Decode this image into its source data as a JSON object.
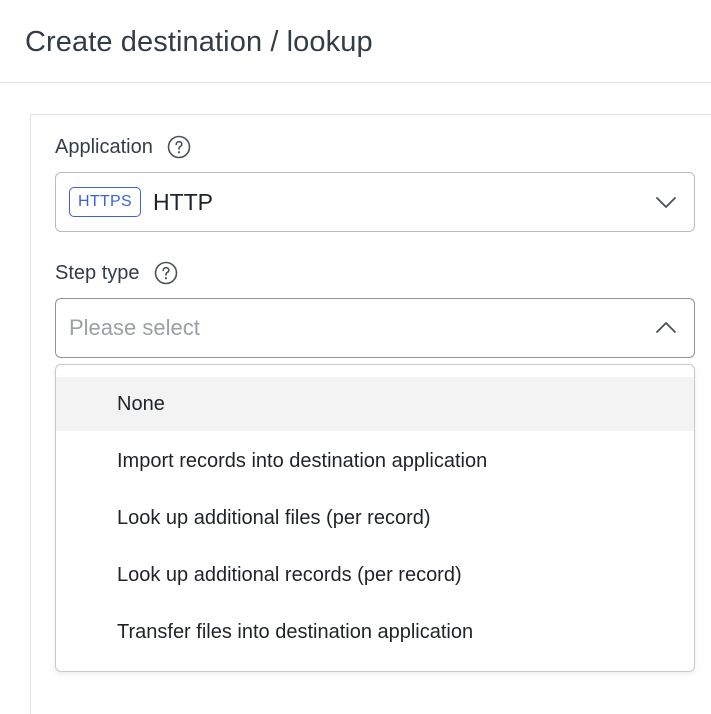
{
  "header": {
    "title": "Create destination / lookup"
  },
  "application_field": {
    "label": "Application",
    "help_icon": "question-circle-icon",
    "badge": "HTTPS",
    "value": "HTTP",
    "chevron": "chevron-down-icon"
  },
  "step_type_field": {
    "label": "Step type",
    "help_icon": "question-circle-icon",
    "placeholder": "Please select",
    "chevron": "chevron-up-icon",
    "expanded": true
  },
  "step_type_options": [
    {
      "label": "None",
      "highlighted": true
    },
    {
      "label": "Import records into destination application",
      "highlighted": false
    },
    {
      "label": "Look up additional files (per record)",
      "highlighted": false
    },
    {
      "label": "Look up additional records (per record)",
      "highlighted": false
    },
    {
      "label": "Transfer files into destination application",
      "highlighted": false
    }
  ],
  "colors": {
    "badge_accent": "#3b63d4",
    "highlight_bg": "#f3f3f3",
    "border": "#b9bcbf"
  }
}
